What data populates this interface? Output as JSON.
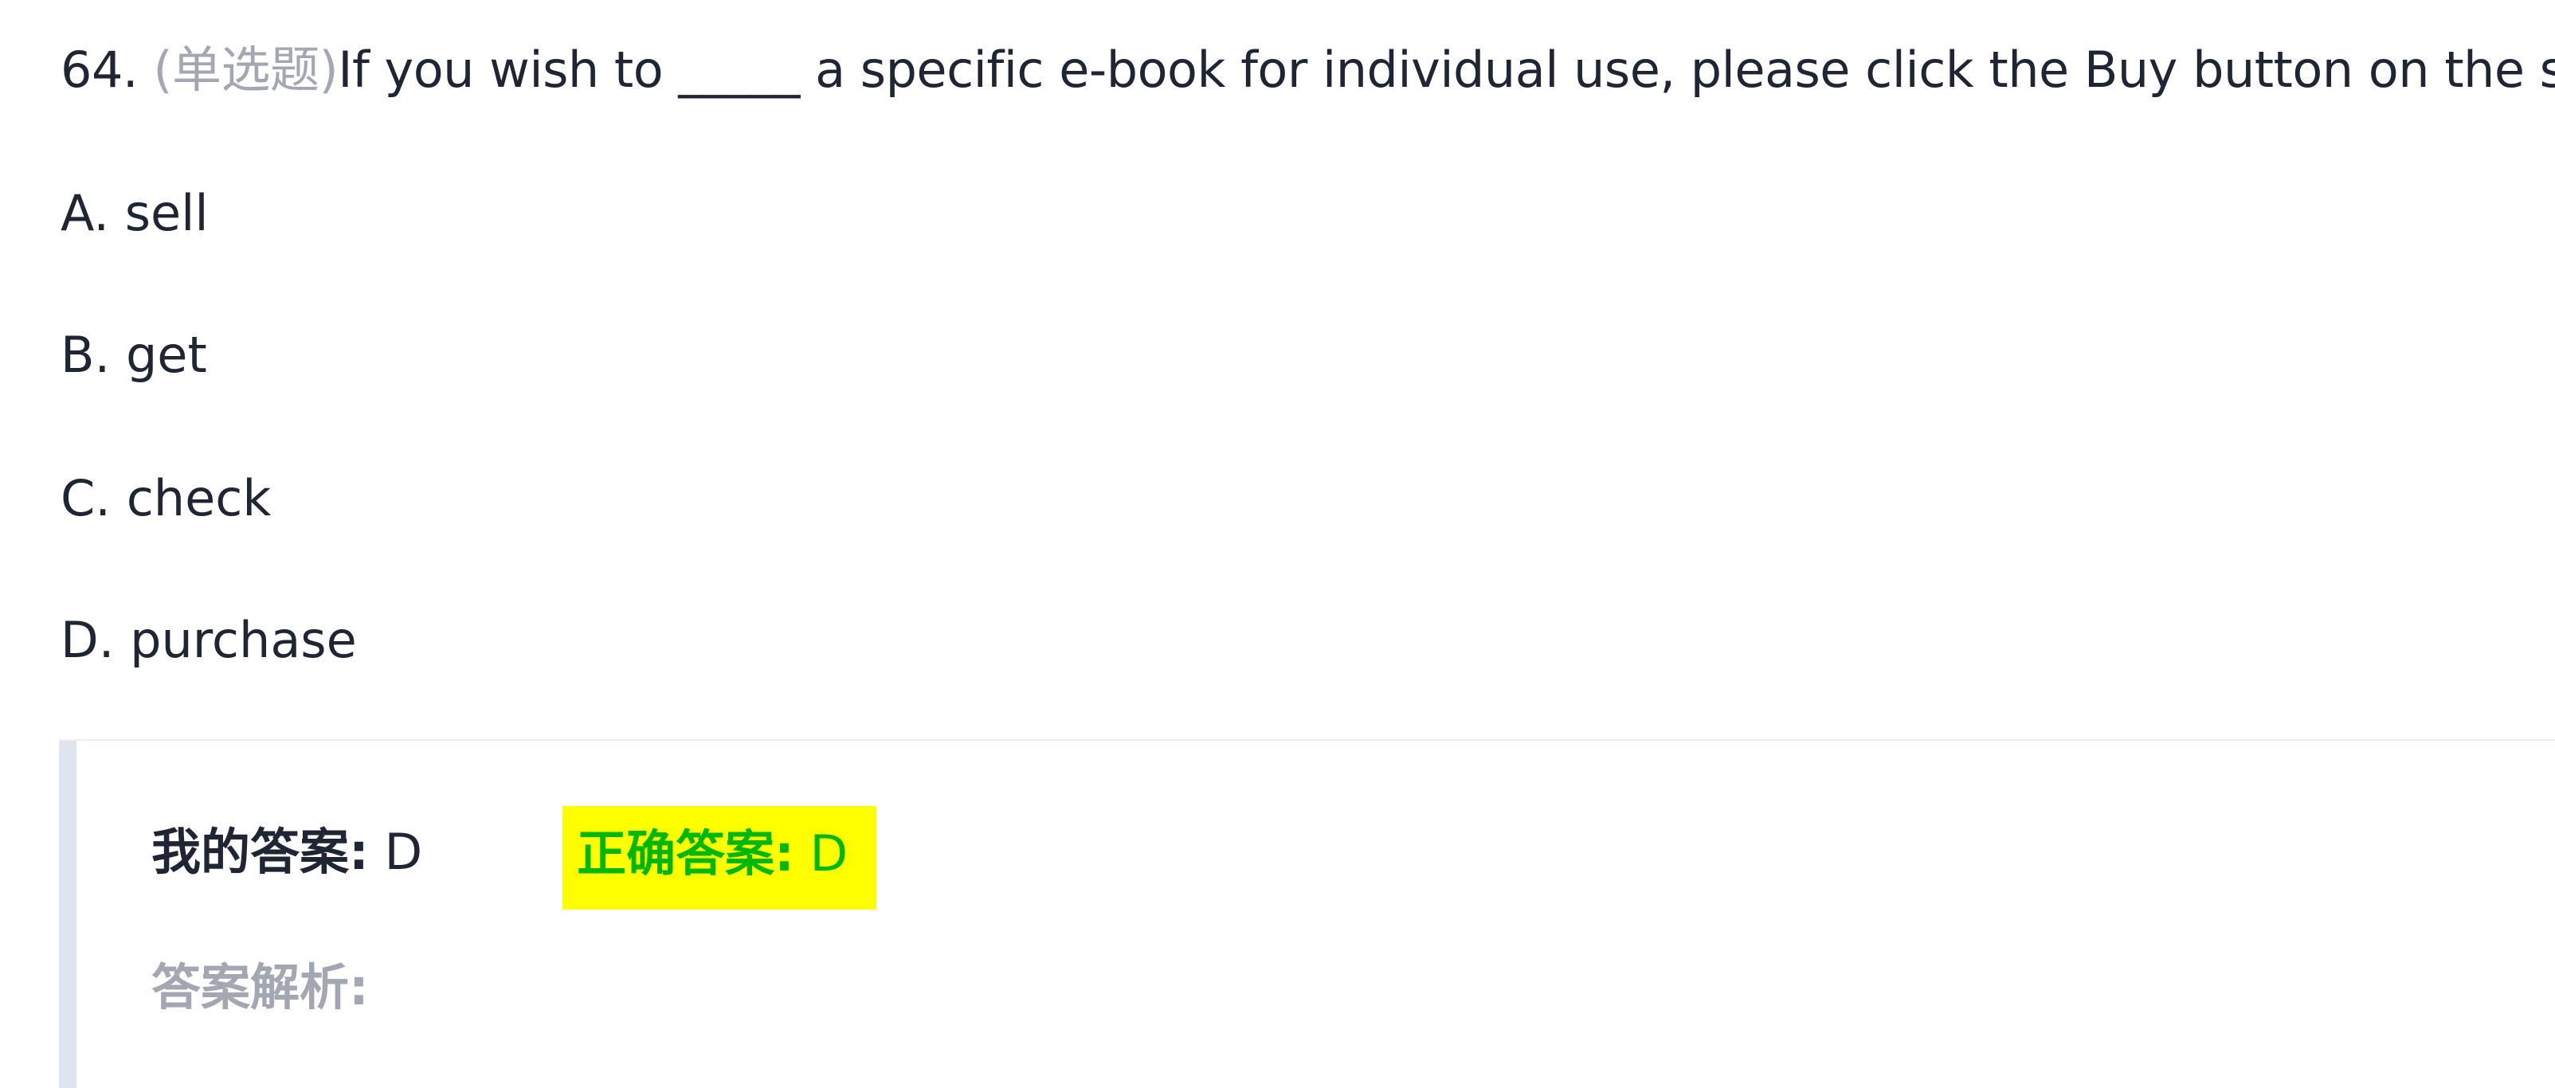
{
  "question": {
    "number": "64.",
    "type": "(单选题)",
    "text": "If you wish to _____ a specific e-book for individual use, please click the Buy button on the site."
  },
  "options": [
    {
      "text": "A. sell"
    },
    {
      "text": "B. get"
    },
    {
      "text": "C. check"
    },
    {
      "text": "D. purchase"
    }
  ],
  "answer_panel": {
    "my_answer_label": "我的答案:",
    "my_answer_value": "D",
    "correct_answer_label": "正确答案:",
    "correct_answer_value": "D",
    "analysis_label": "答案解析:"
  },
  "colors": {
    "text": "#1f2533",
    "muted": "#a3a7b2",
    "correct_green": "#00b800",
    "highlight_yellow": "#ffff00",
    "panel_bar": "#dfe4ef"
  }
}
